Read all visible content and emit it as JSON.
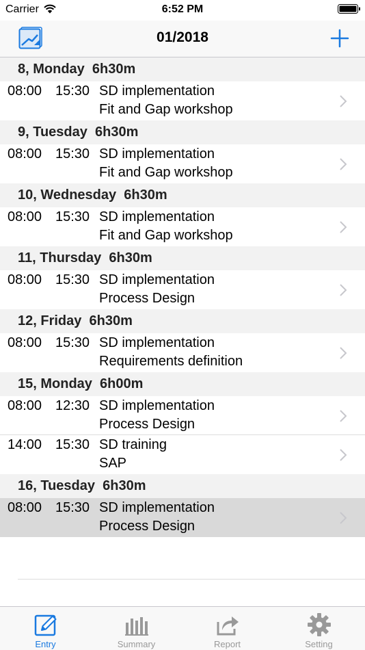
{
  "status": {
    "carrier": "Carrier",
    "time": "6:52 PM"
  },
  "nav": {
    "title": "01/2018",
    "left_icon": "calendar-icon",
    "right_icon": "plus-icon"
  },
  "colors": {
    "accent": "#1a7ae0",
    "header_bg": "#f2f2f2",
    "selected_row": "#d9d9d9",
    "tab_inactive": "#999999"
  },
  "sections": [
    {
      "header": "8, Monday  6h30m",
      "entries": [
        {
          "start": "08:00",
          "end": "15:30",
          "project": "SD implementation",
          "task": "Fit and Gap workshop"
        }
      ]
    },
    {
      "header": "9, Tuesday  6h30m",
      "entries": [
        {
          "start": "08:00",
          "end": "15:30",
          "project": "SD implementation",
          "task": "Fit and Gap workshop"
        }
      ]
    },
    {
      "header": "10, Wednesday  6h30m",
      "entries": [
        {
          "start": "08:00",
          "end": "15:30",
          "project": "SD implementation",
          "task": "Fit and Gap workshop"
        }
      ]
    },
    {
      "header": "11, Thursday  6h30m",
      "entries": [
        {
          "start": "08:00",
          "end": "15:30",
          "project": "SD implementation",
          "task": "Process Design"
        }
      ]
    },
    {
      "header": "12, Friday  6h30m",
      "entries": [
        {
          "start": "08:00",
          "end": "15:30",
          "project": "SD implementation",
          "task": "Requirements definition"
        }
      ]
    },
    {
      "header": "15, Monday  6h00m",
      "entries": [
        {
          "start": "08:00",
          "end": "12:30",
          "project": "SD implementation",
          "task": "Process Design"
        },
        {
          "start": "14:00",
          "end": "15:30",
          "project": "SD training",
          "task": "SAP"
        }
      ]
    },
    {
      "header": "16, Tuesday  6h30m",
      "entries": [
        {
          "start": "08:00",
          "end": "15:30",
          "project": "SD implementation",
          "task": "Process Design",
          "selected": true
        }
      ]
    }
  ],
  "tabs": [
    {
      "label": "Entry",
      "icon": "pencil-icon",
      "active": true
    },
    {
      "label": "Summary",
      "icon": "bar-chart-icon",
      "active": false
    },
    {
      "label": "Report",
      "icon": "share-icon",
      "active": false
    },
    {
      "label": "Setting",
      "icon": "gear-icon",
      "active": false
    }
  ]
}
